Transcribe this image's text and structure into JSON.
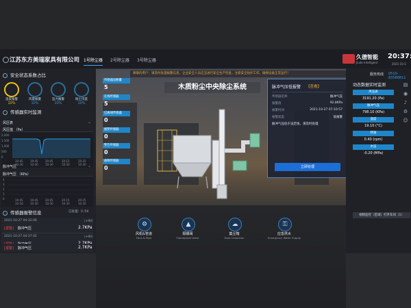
{
  "header": {
    "company": "江苏东方美瑞家具有限公司",
    "tabs": [
      {
        "label": "1号除尘器"
      },
      {
        "label": "2号除尘器"
      },
      {
        "label": "3号除尘器"
      }
    ],
    "brand_name": "久德智能",
    "brand_sub": "Jiude Intelligent",
    "time": "20:37:13",
    "date": "2021-10-3"
  },
  "left": {
    "safety_title": "安全状态系数占比",
    "rings": [
      {
        "label": "温度报警",
        "value": "10%",
        "color": "#f0c419"
      },
      {
        "label": "风量报警",
        "value": "10%",
        "color": "#2f9be6"
      },
      {
        "label": "压力报警",
        "value": "10%",
        "color": "#2f9be6"
      },
      {
        "label": "粉尘浓度",
        "value": "10%",
        "color": "#2f9be6"
      }
    ],
    "sensor_title": "传感器实时监测",
    "chart1": {
      "tab": "风压表",
      "series": "风压值 （Pa）",
      "yticks": [
        "2,000",
        "1,500",
        "1,000",
        "500",
        "0"
      ],
      "xticks": [
        {
          "t": "19:45",
          "d": "10-30"
        },
        {
          "t": "19:45",
          "d": "10-30"
        },
        {
          "t": "20:05",
          "d": "10-30"
        },
        {
          "t": "20:15",
          "d": "10-30"
        },
        {
          "t": "20:25",
          "d": "10-30"
        }
      ]
    },
    "chart2": {
      "tab": "脉冲气压",
      "series": "脉冲气压 （KPa）",
      "yticks": [
        "4",
        "3",
        "2",
        "1",
        "0"
      ],
      "xticks": [
        {
          "t": "19:45",
          "d": "10-30"
        },
        {
          "t": "19:45",
          "d": "10-30"
        },
        {
          "t": "20:05",
          "d": "10-30"
        },
        {
          "t": "20:15",
          "d": "10-30"
        },
        {
          "t": "20:25",
          "d": "10-30"
        }
      ]
    },
    "alarm_title": "传感器报警信息",
    "alarm_count": "已处理：0 /56",
    "alarms": [
      {
        "time": "2021-10-27 04:32:00",
        "level": "（+90）",
        "tag": "[报警]",
        "name": "脉冲气压",
        "value": "2.7KPa"
      },
      {
        "time": "2021-10-27 04:37:45",
        "level": "（+90）",
        "tag": "[报警]",
        "name": "脉冲气压",
        "value": "2.7KPa"
      },
      {
        "time": "",
        "level": "",
        "tag": "[报警]",
        "name": "脉冲气压",
        "value": "2.7KPa"
      }
    ]
  },
  "center": {
    "notice": "尊敬的用户：请及时处理报警信息，企业安全人员应当进行安全生产检查，注意安全防护工作，确保设备正常运行！",
    "title": "木质粉尘中央除尘系统",
    "stats": [
      {
        "label": "传感器总数量",
        "value": "5"
      },
      {
        "label": "在线传感器",
        "value": "5"
      },
      {
        "label": "已离线传感器",
        "value": "0"
      },
      {
        "label": "报警传感器",
        "value": "0"
      },
      {
        "label": "警告传感器",
        "value": "0"
      },
      {
        "label": "故障传感器",
        "value": "0"
      }
    ],
    "popup": {
      "title": "脉冲气压低报警",
      "link": "【查看】",
      "rows": [
        {
          "k": "传感器名称",
          "v": "脉冲气压"
        },
        {
          "k": "报警值",
          "v": "92.8KPa"
        },
        {
          "k": "报警时间",
          "v": "2021-10-27 07:10:57"
        },
        {
          "k": "报警类型",
          "v": "低报警"
        }
      ],
      "message": "脉冲气压低于设定值，请及时处理",
      "button": "立即处理"
    },
    "quick": [
      {
        "cn": "风机&管道",
        "en": "Fans & Pipe",
        "icon": "⚙"
      },
      {
        "cn": "隔爆阀",
        "en": "Flameproof Valve",
        "icon": "▲"
      },
      {
        "cn": "集尘箱",
        "en": "Dust Collection",
        "icon": "☁"
      },
      {
        "cn": "应急供水",
        "en": "Emergency Water Supply",
        "icon": "⚿"
      }
    ]
  },
  "right": {
    "service_label": "服务热线",
    "service_number": "0510-83588811",
    "monitor_title": "动态数据实时监测",
    "metrics": [
      {
        "label": "风压表",
        "value": "3191.20 (Pa)"
      },
      {
        "label": "脉冲气压",
        "value": "798.10 (KPa)"
      },
      {
        "label": "温度",
        "value": "19.10 (°C)"
      },
      {
        "label": "转速",
        "value": "0.40 (rpm)"
      },
      {
        "label": "水压",
        "value": "-0.20 (MPa)"
      }
    ],
    "video_btn": "视频监控（区域）打开车间（1）"
  },
  "colors": {
    "accent": "#1f86c9",
    "alarm": "#e2434a",
    "warning": "#e6a83a",
    "brand_red": "#c8363a"
  }
}
